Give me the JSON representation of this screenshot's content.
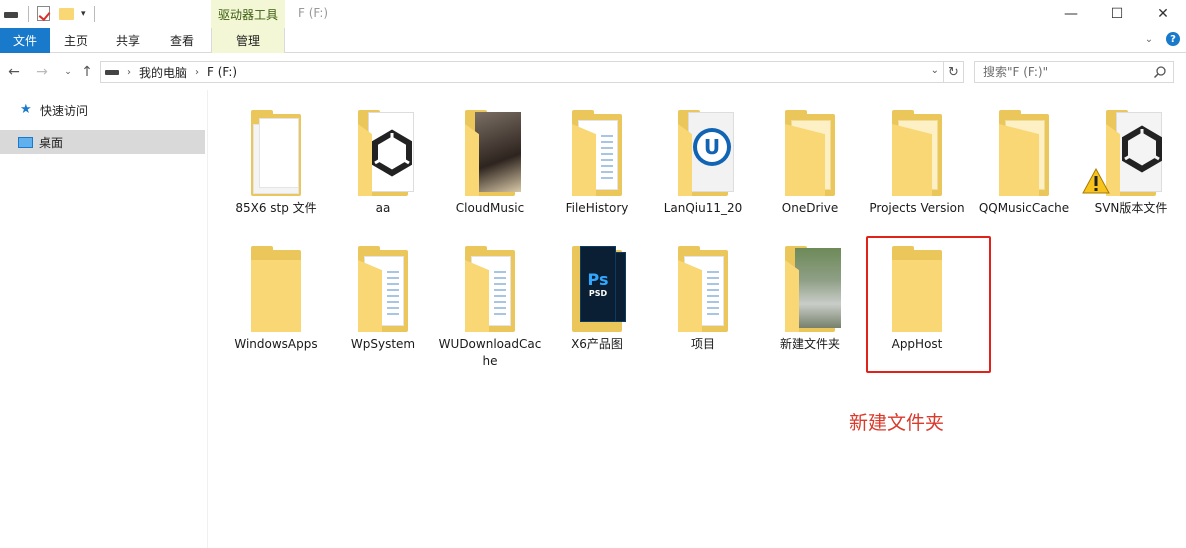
{
  "titlebar": {
    "context_tab": "驱动器工具",
    "window_title": "F (F:)",
    "minimize": "—",
    "maximize": "☐",
    "close": "✕"
  },
  "ribbon": {
    "tabs": [
      {
        "label": "文件",
        "active": true
      },
      {
        "label": "主页"
      },
      {
        "label": "共享"
      },
      {
        "label": "查看"
      },
      {
        "label": "管理"
      }
    ]
  },
  "address": {
    "crumbs": [
      "我的电脑",
      "F (F:)"
    ],
    "search_placeholder": "搜索\"F (F:)\""
  },
  "sidebar": {
    "items": [
      {
        "label": "快速访问",
        "icon": "star-icon"
      },
      {
        "label": "桌面",
        "icon": "desktop-icon",
        "selected": true
      }
    ]
  },
  "files": [
    {
      "name": "85X6 stp 文件",
      "type": "folder-docs"
    },
    {
      "name": "aa",
      "type": "unity"
    },
    {
      "name": "CloudMusic",
      "type": "concert-photo"
    },
    {
      "name": "FileHistory",
      "type": "folder-lines"
    },
    {
      "name": "LanQiu11_20",
      "type": "unreal"
    },
    {
      "name": "OneDrive",
      "type": "folder"
    },
    {
      "name": "Projects Version",
      "type": "folder"
    },
    {
      "name": "QQMusicCache",
      "type": "folder"
    },
    {
      "name": "SVN版本文件",
      "type": "unity-warning"
    },
    {
      "name": "WindowsApps",
      "type": "folder"
    },
    {
      "name": "WpSystem",
      "type": "folder-lines"
    },
    {
      "name": "WUDownloadCache",
      "type": "folder-lines"
    },
    {
      "name": "X6产品图",
      "type": "photoshop"
    },
    {
      "name": "项目",
      "type": "folder-lines"
    },
    {
      "name": "新建文件夹",
      "type": "road-photo"
    },
    {
      "name": "AppHost",
      "type": "folder-empty"
    }
  ],
  "annotation": {
    "text": "新建文件夹",
    "color": "#d93a2b"
  },
  "colors": {
    "accent": "#1979ca",
    "context_tab_bg": "#f3f7d6",
    "folder": "#f8d774",
    "highlight": "#e0221b"
  }
}
